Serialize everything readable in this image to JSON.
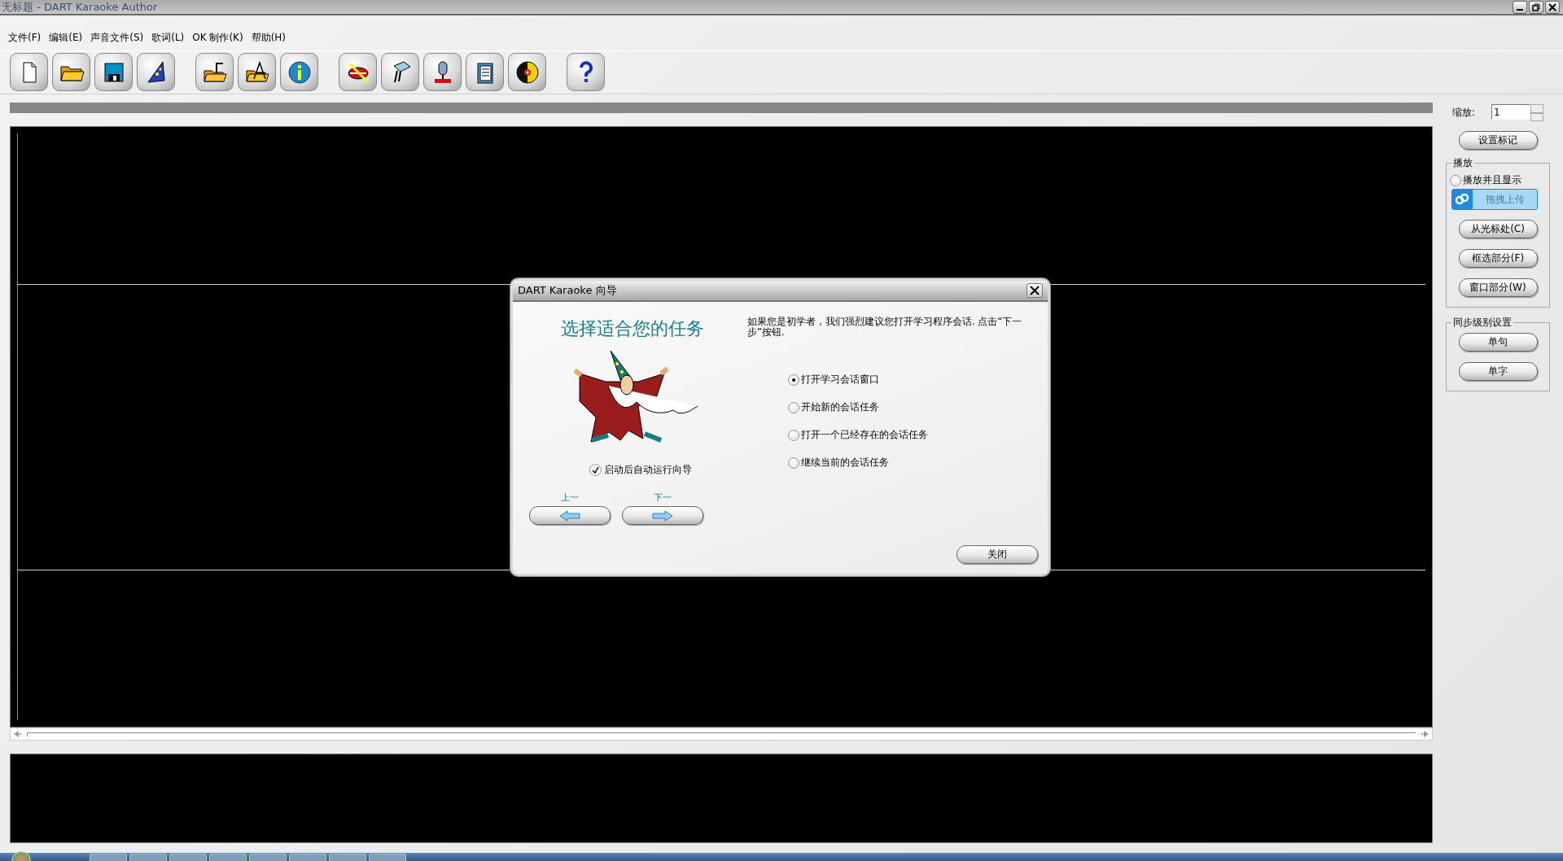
{
  "window": {
    "title": "无标题 - DART Karaoke Author"
  },
  "menu": [
    "文件(F)",
    "编辑(E)",
    "声音文件(S)",
    "歌词(L)",
    "OK 制作(K)",
    "帮助(H)"
  ],
  "zoom": {
    "label": "缩放:",
    "value": "1"
  },
  "set_marker_button": "设置标记",
  "playback": {
    "title": "播放",
    "option": {
      "label": "播放并且显示",
      "selected": false
    },
    "buttons": [
      "从光标处(C)",
      "框选部分(F)",
      "窗口部分(W)"
    ]
  },
  "upload_overlay": {
    "label": "拖拽上传"
  },
  "sync_level": {
    "title": "同步级别设置",
    "buttons": [
      "单句",
      "单字"
    ]
  },
  "dialog": {
    "title": "DART Karaoke 向导",
    "heading": "选择适合您的任务",
    "description": "如果您是初学者，我们强烈建议您打开学习程序会话. 点击“下一步”按钮.",
    "options": [
      {
        "label": "打开学习会话窗口",
        "selected": true
      },
      {
        "label": "开始新的会话任务",
        "selected": false
      },
      {
        "label": "打开一个已经存在的会话任务",
        "selected": false
      },
      {
        "label": "继续当前的会话任务",
        "selected": false
      }
    ],
    "autorun": {
      "label": "启动后自动运行向导",
      "checked": true
    },
    "back": {
      "label": "上一"
    },
    "next": {
      "label": "下一"
    },
    "close_button": "关闭"
  }
}
